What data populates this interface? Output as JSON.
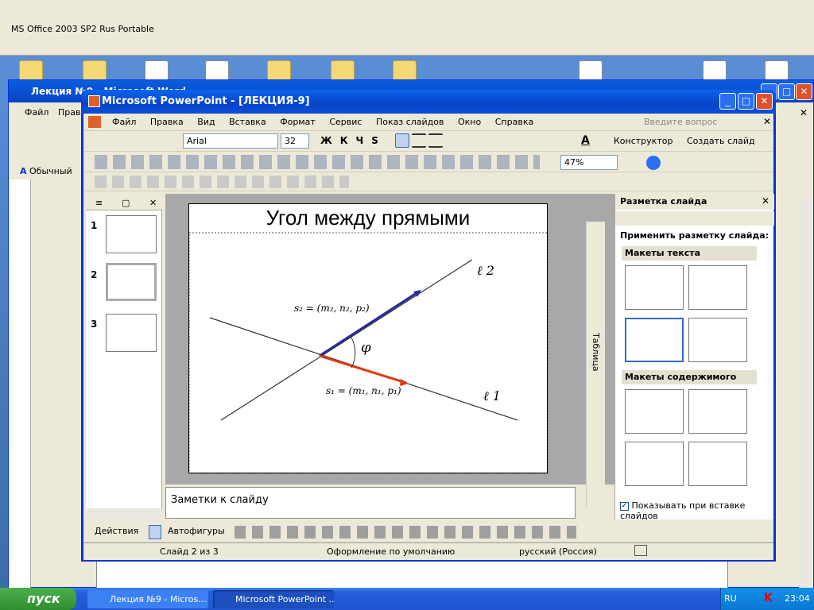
{
  "topbar": {
    "label": "MS Office 2003 SP2 Rus Portable"
  },
  "word": {
    "title": "Лекция №9 - Microsoft Word",
    "menu": [
      "Файл",
      "Правка"
    ],
    "style_box": "Обычный"
  },
  "ppt": {
    "title": "Microsoft PowerPoint - [ЛЕКЦИЯ-9]",
    "menu": [
      "Файл",
      "Правка",
      "Вид",
      "Вставка",
      "Формат",
      "Сервис",
      "Показ слайдов",
      "Окно",
      "Справка"
    ],
    "help_placeholder": "Введите вопрос",
    "font_name": "Arial",
    "font_size": "32",
    "designer_label": "Конструктор",
    "new_slide_label": "Создать слайд",
    "zoom": "47%"
  },
  "slide": {
    "title": "Угол между прямыми",
    "label_l2": "ℓ 2",
    "label_l1": "ℓ 1",
    "label_phi": "φ",
    "label_s2": "s₂ = (m₂, n₂, p₂)",
    "label_s1": "s₁ = (m₁, n₁, p₁)"
  },
  "thumbs": [
    {
      "num": "1"
    },
    {
      "num": "2"
    },
    {
      "num": "3"
    }
  ],
  "notes_placeholder": "Заметки к слайду",
  "drawing_toolbar": {
    "actions": "Действия",
    "autoshapes": "Автофигуры"
  },
  "taskpane": {
    "title": "Разметка слайда",
    "apply_label": "Применить разметку слайда:",
    "section_text": "Макеты текста",
    "section_content": "Макеты содержимого",
    "show_on_insert": "Показывать при вставке слайдов",
    "table_tab": "Таблица"
  },
  "status": {
    "slide": "Слайд 2 из 3",
    "design": "Оформление по умолчанию",
    "language": "русский (Россия)"
  },
  "taskbar": {
    "start": "пуск",
    "tasks": [
      "Лекция №9 - Micros...",
      "Microsoft PowerPoint ..."
    ],
    "lang": "RU",
    "time": "23:04"
  },
  "colors": {
    "xp_blue": "#0843c8",
    "red_vector": "#e03a10",
    "blue_vector": "#2a2a9a"
  }
}
